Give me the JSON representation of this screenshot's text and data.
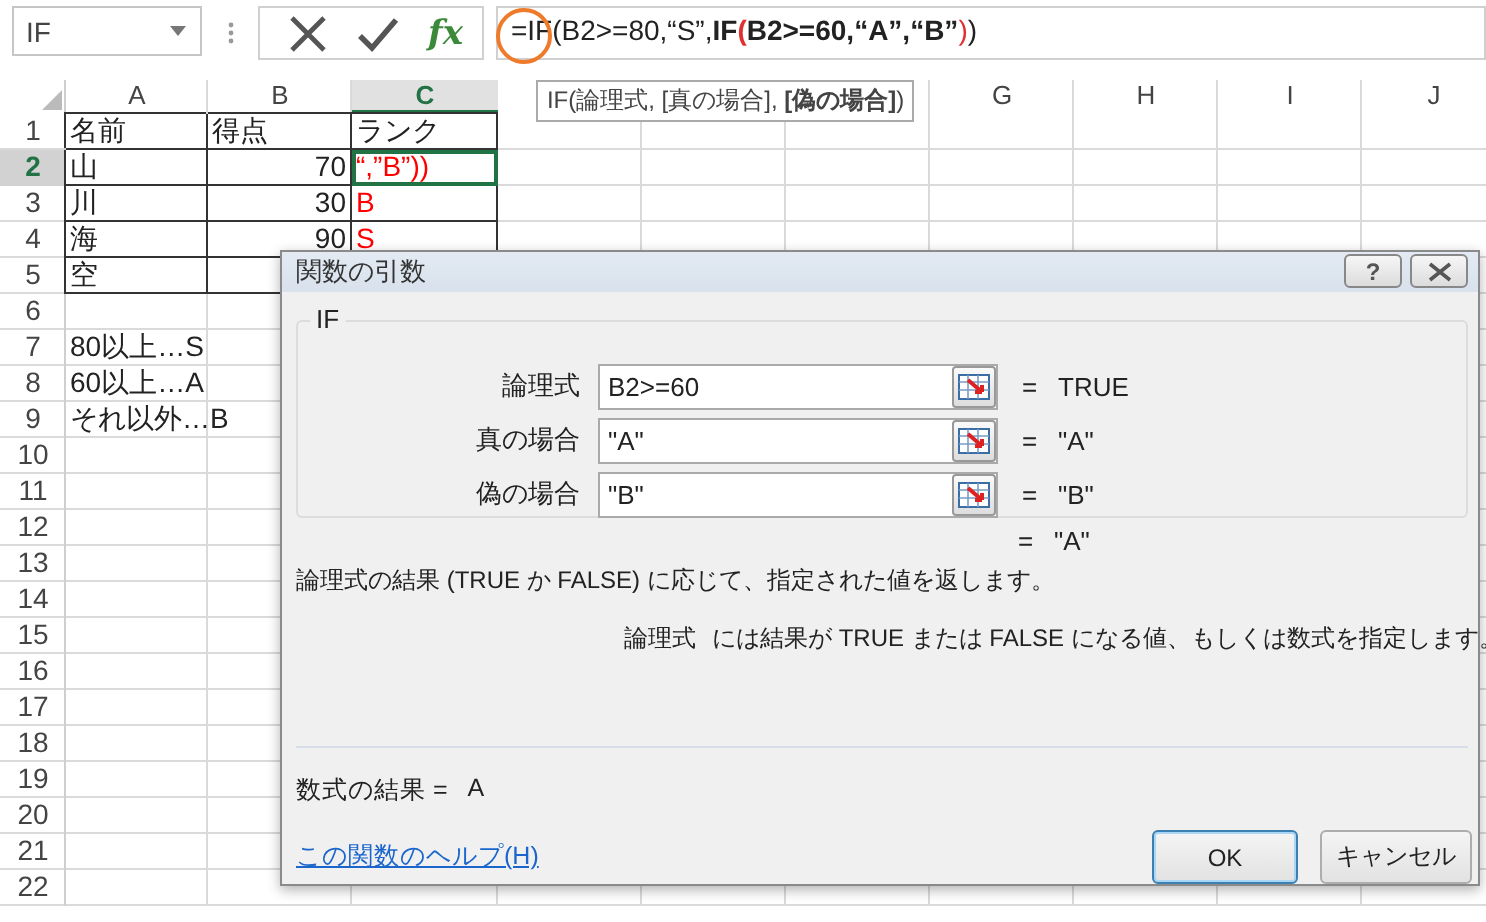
{
  "name_box": {
    "value": "IF"
  },
  "formula_bar": {
    "fx_label": "fx",
    "formula": [
      {
        "text": "=IF(B2>=80,“S”,",
        "kind": "plain"
      },
      {
        "text": "IF",
        "kind": "bold"
      },
      {
        "text": "(",
        "kind": "bold-red"
      },
      {
        "text": "B2>=60,“A”,“B”",
        "kind": "bold"
      },
      {
        "text": ")",
        "kind": "red"
      },
      {
        "text": ")",
        "kind": "plain"
      }
    ],
    "tooltip": "IF(論理式, [真の場合], **[偽の場合]**)"
  },
  "columns_left": [
    {
      "label": "A",
      "selected": false
    },
    {
      "label": "B",
      "selected": false
    },
    {
      "label": "C",
      "selected": true
    }
  ],
  "columns_right": [
    {
      "label": "G",
      "selected": false
    },
    {
      "label": "H",
      "selected": false
    },
    {
      "label": "I",
      "selected": false
    },
    {
      "label": "J",
      "selected": false
    }
  ],
  "rows": [
    {
      "header": "1",
      "selected": false,
      "bordered": true,
      "cells": [
        {
          "text": "名前",
          "kind": "text",
          "selected": false
        },
        {
          "text": "得点",
          "kind": "text",
          "selected": false
        },
        {
          "text": "ランク",
          "kind": "text",
          "selected": false
        }
      ]
    },
    {
      "header": "2",
      "selected": true,
      "bordered": true,
      "cells": [
        {
          "text": "山",
          "kind": "text",
          "selected": false
        },
        {
          "text": "70",
          "kind": "number",
          "selected": false
        },
        {
          "text": "“,”B”))",
          "kind": "text",
          "selected": true,
          "color": "#ff0000"
        }
      ]
    },
    {
      "header": "3",
      "selected": false,
      "bordered": true,
      "cells": [
        {
          "text": "川",
          "kind": "text",
          "selected": false
        },
        {
          "text": "30",
          "kind": "number",
          "selected": false
        },
        {
          "text": "B",
          "kind": "text",
          "selected": false,
          "color": "#ff0000"
        }
      ]
    },
    {
      "header": "4",
      "selected": false,
      "bordered": true,
      "cells": [
        {
          "text": "海",
          "kind": "text",
          "selected": false
        },
        {
          "text": "90",
          "kind": "number",
          "selected": false
        },
        {
          "text": "S",
          "kind": "text",
          "selected": false,
          "color": "#ff0000"
        }
      ]
    },
    {
      "header": "5",
      "selected": false,
      "bordered": true,
      "cells": [
        {
          "text": "空",
          "kind": "text",
          "selected": false
        }
      ]
    },
    {
      "header": "6",
      "selected": false,
      "bordered": false,
      "cells": []
    },
    {
      "header": "7",
      "selected": false,
      "bordered": false,
      "cells": [
        {
          "text": "80以上…S",
          "kind": "text",
          "selected": false
        }
      ]
    },
    {
      "header": "8",
      "selected": false,
      "bordered": false,
      "cells": [
        {
          "text": "60以上…A",
          "kind": "text",
          "selected": false
        }
      ]
    },
    {
      "header": "9",
      "selected": false,
      "bordered": false,
      "cells": [
        {
          "text": "それ以外…B",
          "kind": "text",
          "selected": false
        }
      ]
    },
    {
      "header": "10",
      "selected": false,
      "bordered": false,
      "cells": []
    },
    {
      "header": "11",
      "selected": false,
      "bordered": false,
      "cells": []
    },
    {
      "header": "12",
      "selected": false,
      "bordered": false,
      "cells": []
    },
    {
      "header": "13",
      "selected": false,
      "bordered": false,
      "cells": []
    },
    {
      "header": "14",
      "selected": false,
      "bordered": false,
      "cells": []
    },
    {
      "header": "15",
      "selected": false,
      "bordered": false,
      "cells": []
    },
    {
      "header": "16",
      "selected": false,
      "bordered": false,
      "cells": []
    },
    {
      "header": "17",
      "selected": false,
      "bordered": false,
      "cells": []
    },
    {
      "header": "18",
      "selected": false,
      "bordered": false,
      "cells": []
    },
    {
      "header": "19",
      "selected": false,
      "bordered": false,
      "cells": []
    },
    {
      "header": "20",
      "selected": false,
      "bordered": false,
      "cells": []
    },
    {
      "header": "21",
      "selected": false,
      "bordered": false,
      "cells": []
    },
    {
      "header": "22",
      "selected": false,
      "bordered": false,
      "cells": []
    }
  ],
  "dialog": {
    "title": "関数の引数",
    "help_glyph": "?",
    "function_name": "IF",
    "args": [
      {
        "label": "論理式",
        "value": "B2>=60",
        "equals": "=",
        "result": "TRUE"
      },
      {
        "label": "真の場合",
        "value": "\"A\"",
        "equals": "=",
        "result": "\"A\""
      },
      {
        "label": "偽の場合",
        "value": "\"B\"",
        "equals": "=",
        "result": "\"B\""
      }
    ],
    "overall": {
      "equals": "=",
      "result": "\"A\""
    },
    "description": "論理式の結果 (TRUE か FALSE) に応じて、指定された値を返します。",
    "arg_help": {
      "name": "論理式",
      "text": "には結果が TRUE または FALSE になる値、もしくは数式を指定します。"
    },
    "formula_result": {
      "label": "数式の結果 =",
      "value": "A"
    },
    "help_link": "この関数のヘルプ(H)",
    "buttons": [
      {
        "label": "OK",
        "kind": "default"
      },
      {
        "label": "キャンセル",
        "kind": "normal"
      }
    ]
  }
}
